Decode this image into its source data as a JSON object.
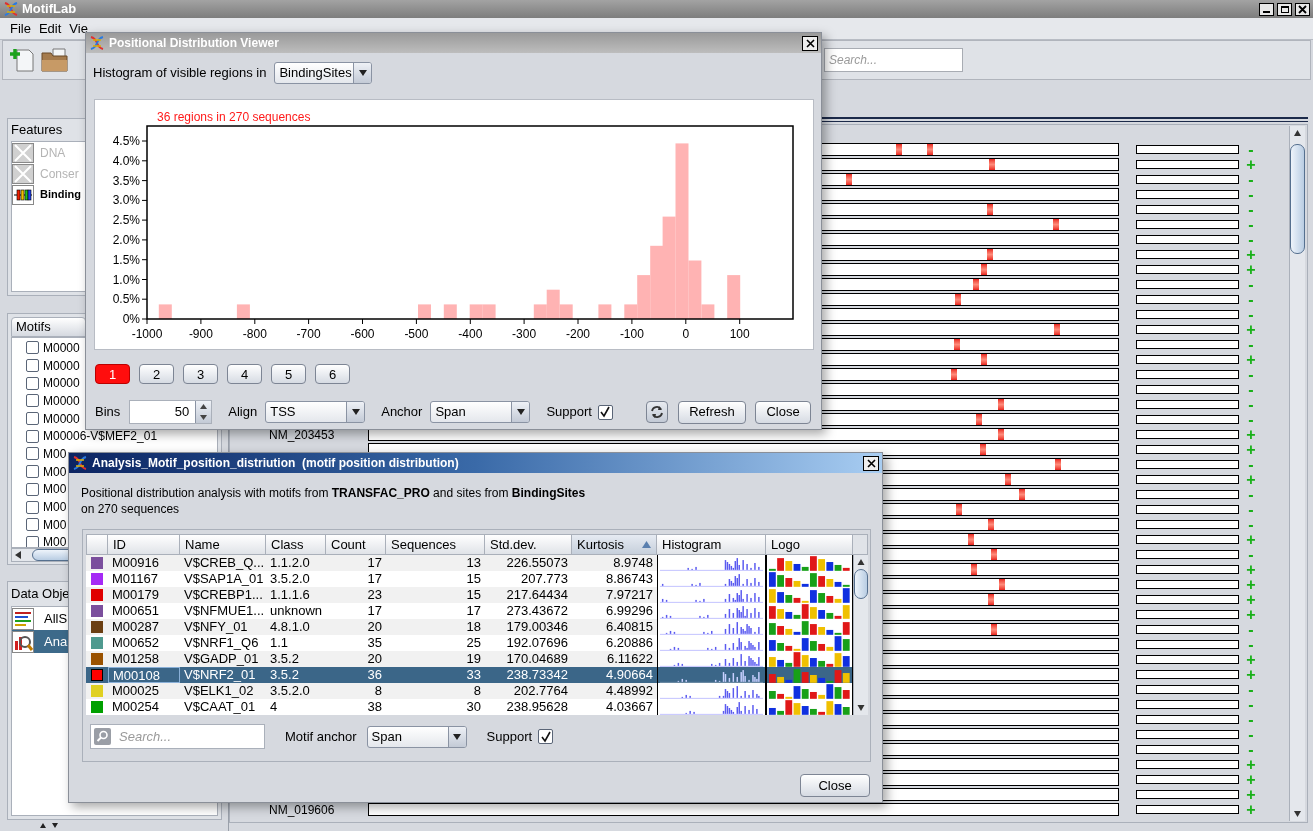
{
  "main_window": {
    "title": "MotifLab",
    "menu": [
      "File",
      "Edit",
      "Vie"
    ],
    "search": {
      "placeholder": "Search..."
    }
  },
  "features_panel": {
    "title": "Features",
    "items": [
      {
        "label": "DNA",
        "hidden": true
      },
      {
        "label": "Conser",
        "hidden": true
      },
      {
        "label": "Binding",
        "kind": "region",
        "hidden": false
      }
    ]
  },
  "motifs_panel": {
    "title": "Motifs",
    "items": [
      {
        "label": "M0000",
        "checked": false
      },
      {
        "label": "M0000",
        "checked": false
      },
      {
        "label": "M0000",
        "checked": false
      },
      {
        "label": "M0000",
        "checked": false
      },
      {
        "label": "M0000",
        "checked": false
      },
      {
        "label": "M00006-V$MEF2_01",
        "checked": false
      },
      {
        "label": "M00",
        "checked": false
      },
      {
        "label": "M00",
        "checked": false
      },
      {
        "label": "M00",
        "checked": false
      },
      {
        "label": "M00",
        "checked": false
      },
      {
        "label": "M00",
        "checked": false
      },
      {
        "label": "M00",
        "checked": false
      }
    ]
  },
  "data_objects_panel": {
    "title": "Data Obje",
    "items": [
      {
        "label": "AllS",
        "kind": "collection",
        "selected": false
      },
      {
        "label": "Ana",
        "kind": "analysis",
        "selected": true
      }
    ]
  },
  "sequences": [
    {
      "strand": "-"
    },
    {
      "strand": "+"
    },
    {
      "strand": "-"
    },
    {
      "strand": "-"
    },
    {
      "strand": "-"
    },
    {
      "strand": "-"
    },
    {
      "strand": "-"
    },
    {
      "strand": "+"
    },
    {
      "strand": "+"
    },
    {
      "strand": "-"
    },
    {
      "strand": "-"
    },
    {
      "strand": "-"
    },
    {
      "strand": "+"
    },
    {
      "strand": "-"
    },
    {
      "strand": "+"
    },
    {
      "strand": "-"
    },
    {
      "strand": "-"
    },
    {
      "strand": "-"
    },
    {
      "strand": "-"
    },
    {
      "name": "NM_203453",
      "strand": "+"
    },
    {
      "strand": "+"
    },
    {
      "strand": "-"
    },
    {
      "strand": "+"
    },
    {
      "strand": "-"
    },
    {
      "strand": "-"
    },
    {
      "strand": "-"
    },
    {
      "strand": "+"
    },
    {
      "strand": "-"
    },
    {
      "strand": "+"
    },
    {
      "strand": "+"
    },
    {
      "strand": "+"
    },
    {
      "strand": "+"
    },
    {
      "strand": "-"
    },
    {
      "strand": "-"
    },
    {
      "strand": "+"
    },
    {
      "strand": "+"
    },
    {
      "strand": "-"
    },
    {
      "strand": "-"
    },
    {
      "strand": "-"
    },
    {
      "strand": "-"
    },
    {
      "strand": "-"
    },
    {
      "strand": "+"
    },
    {
      "strand": "+"
    },
    {
      "strand": "+"
    },
    {
      "name": "NM_019606",
      "strand": "+"
    }
  ],
  "distribution_viewer": {
    "title": "Positional Distribution Viewer",
    "source_label": "Histogram of visible regions in",
    "source": "BindingSites",
    "chart_data": {
      "type": "bar",
      "title": "36 regions in 270 sequences",
      "x": [
        -966,
        -821,
        -485,
        -437,
        -389,
        -365,
        -270,
        -246,
        -222,
        -150,
        -102,
        -78,
        -54,
        -31,
        -7,
        17,
        41,
        89
      ],
      "values": [
        0.37,
        0.37,
        0.37,
        0.37,
        0.37,
        0.37,
        0.37,
        0.74,
        0.37,
        0.37,
        0.37,
        1.11,
        1.85,
        2.59,
        4.44,
        1.48,
        0.37,
        1.11
      ],
      "xlim": [
        -1000,
        199
      ],
      "ylim": [
        0,
        4.88
      ],
      "xticks": [
        -1000,
        -900,
        -800,
        -700,
        -600,
        -500,
        -400,
        -300,
        -200,
        -100,
        0,
        100
      ],
      "yticks": [
        {
          "value": 0,
          "label": "0%"
        },
        {
          "value": 0.5,
          "label": "0.5%"
        },
        {
          "value": 1,
          "label": "1.0%"
        },
        {
          "value": 1.5,
          "label": "1.5%"
        },
        {
          "value": 2,
          "label": "2.0%"
        },
        {
          "value": 2.5,
          "label": "2.5%"
        },
        {
          "value": 3,
          "label": "3.0%"
        },
        {
          "value": 3.5,
          "label": "3.5%"
        },
        {
          "value": 4,
          "label": "4.0%"
        },
        {
          "value": 4.5,
          "label": "4.5%"
        }
      ]
    },
    "pages": [
      {
        "label": "1",
        "selected": true
      },
      {
        "label": "2",
        "selected": false
      },
      {
        "label": "3",
        "selected": false
      },
      {
        "label": "4",
        "selected": false
      },
      {
        "label": "5",
        "selected": false
      },
      {
        "label": "6",
        "selected": false
      }
    ],
    "bins_label": "Bins",
    "bins": "50",
    "align_label": "Align",
    "align": "TSS",
    "anchor_label": "Anchor",
    "anchor": "Span",
    "support_label": "Support",
    "support_checked": true,
    "buttons": [
      "Refresh",
      "Close"
    ]
  },
  "analysis_window": {
    "title": "Analysis_Motif_position_distriution  (motif position distribution)",
    "description_lines": [
      "Positional distribution analysis with motifs from **TRANSFAC_PRO** and sites from **BindingSites**",
      "on 270 sequences"
    ],
    "table": {
      "columns": [
        {
          "label": "ID",
          "sorted": false
        },
        {
          "label": "Name",
          "sorted": false
        },
        {
          "label": "Class",
          "sorted": false
        },
        {
          "label": "Count",
          "sorted": false
        },
        {
          "label": "Sequences",
          "sorted": false
        },
        {
          "label": "Std.dev.",
          "sorted": false
        },
        {
          "label": "Kurtosis",
          "sorted": true
        },
        {
          "label": "Histogram",
          "sorted": false
        },
        {
          "label": "Logo",
          "sorted": false
        }
      ],
      "rows": [
        {
          "color": "#7b4f9d",
          "cells": [
            "M00916",
            "V$CREB_Q...",
            "1.1.2.0",
            "17",
            "13",
            "226.55073",
            "8.9748"
          ],
          "selected": false
        },
        {
          "color": "#a52af5",
          "cells": [
            "M01167",
            "V$SAP1A_01",
            "3.5.2.0",
            "17",
            "15",
            "207.773",
            "8.86743"
          ],
          "selected": false
        },
        {
          "color": "#e00000",
          "cells": [
            "M00179",
            "V$CREBP1...",
            "1.1.1.6",
            "23",
            "15",
            "217.64434",
            "7.97217"
          ],
          "selected": false
        },
        {
          "color": "#7b4f9d",
          "cells": [
            "M00651",
            "V$NFMUE1...",
            "unknown",
            "17",
            "17",
            "273.43672",
            "6.99296"
          ],
          "selected": false
        },
        {
          "color": "#6b3f12",
          "cells": [
            "M00287",
            "V$NFY_01",
            "4.8.1.0",
            "20",
            "18",
            "179.00346",
            "6.40815"
          ],
          "selected": false
        },
        {
          "color": "#4f9a8f",
          "cells": [
            "M00652",
            "V$NRF1_Q6",
            "1.1",
            "35",
            "25",
            "192.07696",
            "6.20886"
          ],
          "selected": false
        },
        {
          "color": "#9a5200",
          "cells": [
            "M01258",
            "V$GADP_01",
            "3.5.2",
            "20",
            "19",
            "170.04689",
            "6.11622"
          ],
          "selected": false
        },
        {
          "color": "#ff0000",
          "cells": [
            "M00108",
            "V$NRF2_01",
            "3.5.2",
            "36",
            "33",
            "238.73342",
            "4.90664"
          ],
          "selected": true
        },
        {
          "color": "#e0d020",
          "cells": [
            "M00025",
            "V$ELK1_02",
            "3.5.2.0",
            "8",
            "8",
            "202.7764",
            "4.48992"
          ],
          "selected": false
        },
        {
          "color": "#00a000",
          "cells": [
            "M00254",
            "V$CAAT_01",
            "4",
            "38",
            "30",
            "238.95628",
            "4.03667"
          ],
          "selected": false
        }
      ]
    },
    "search": {
      "placeholder": "Search..."
    },
    "anchor_label": "Motif anchor",
    "anchor": "Span",
    "support_label": "Support",
    "support_checked": true,
    "close": "Close"
  }
}
